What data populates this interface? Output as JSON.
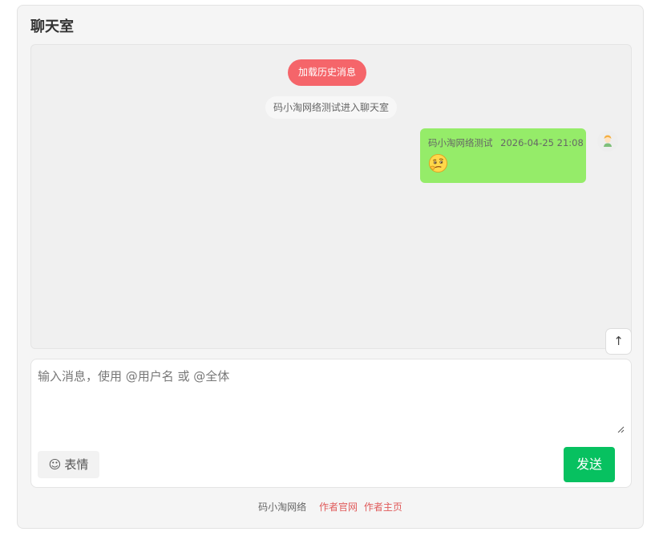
{
  "chat": {
    "title": "聊天室",
    "load_history_label": "加载历史消息",
    "system_notice": "码小淘网络测试进入聊天室",
    "messages": [
      {
        "sender": "码小淘网络测试",
        "time": "2026-04-25 21:08",
        "content_icon": "thinking-face-emoji-icon"
      }
    ],
    "avatar_icon": "user-avatar-icon"
  },
  "scroll": {
    "up_label": "↑",
    "down_label": "↓"
  },
  "composer": {
    "placeholder": "输入消息，使用 @用户名 或 @全体",
    "value": "",
    "emoji_label": "表情",
    "emoji_icon_glyph": "☺",
    "send_label": "发送"
  },
  "footer": {
    "brand": "码小淘网络",
    "links": [
      "作者官网",
      "作者主页"
    ]
  },
  "colors": {
    "load_history_bg": "#f5656a",
    "bubble_bg": "#95ec69",
    "send_bg": "#07c160",
    "footer_link": "#e05a5a"
  }
}
